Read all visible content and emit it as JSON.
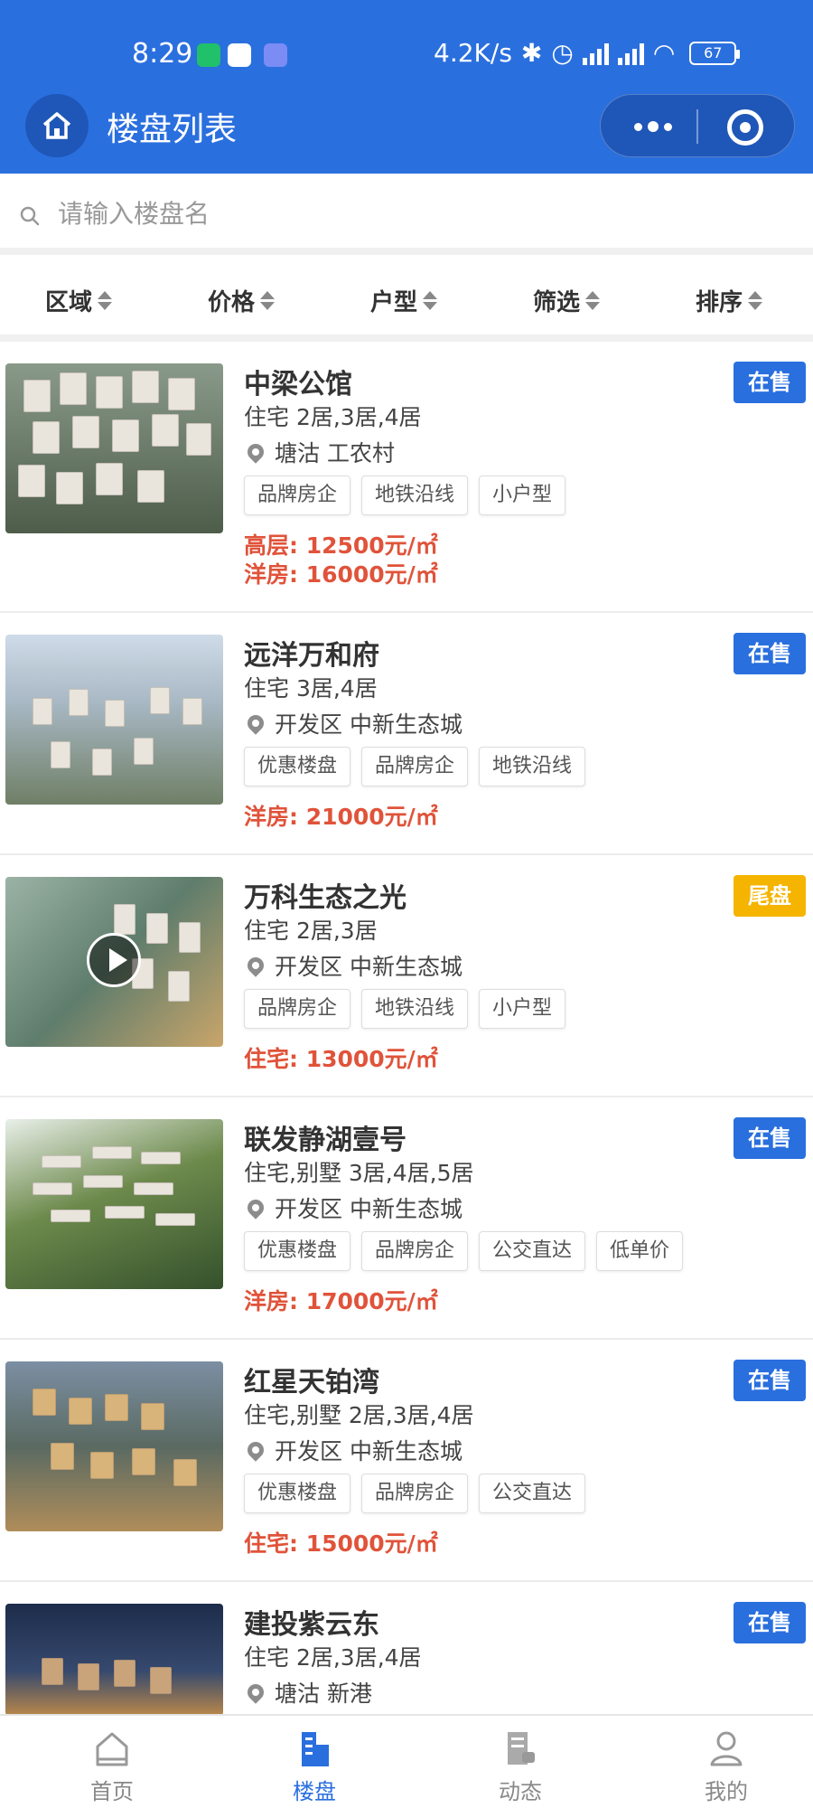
{
  "status": {
    "time": "8:29",
    "net_speed": "4.2K/s",
    "battery": "67"
  },
  "header": {
    "title": "楼盘列表"
  },
  "search": {
    "placeholder": "请输入楼盘名"
  },
  "filters": [
    "区域",
    "价格",
    "户型",
    "筛选",
    "排序"
  ],
  "colors": {
    "primary": "#2a6fde",
    "price": "#e0533a",
    "badge_on_sale": "#2a6fde",
    "badge_last": "#f5b400"
  },
  "listings": [
    {
      "name": "中梁公馆",
      "types": "住宅 2居,3居,4居",
      "location": "塘沽 工农村",
      "tags": [
        "品牌房企",
        "地铁沿线",
        "小户型"
      ],
      "prices": [
        "高层: 12500元/㎡",
        "洋房: 16000元/㎡"
      ],
      "badge": "在售",
      "badge_color": "#2a6fde"
    },
    {
      "name": "远洋万和府",
      "types": "住宅 3居,4居",
      "location": "开发区 中新生态城",
      "tags": [
        "优惠楼盘",
        "品牌房企",
        "地铁沿线"
      ],
      "prices": [
        "洋房: 21000元/㎡"
      ],
      "badge": "在售",
      "badge_color": "#2a6fde"
    },
    {
      "name": "万科生态之光",
      "types": "住宅 2居,3居",
      "location": "开发区 中新生态城",
      "tags": [
        "品牌房企",
        "地铁沿线",
        "小户型"
      ],
      "prices": [
        "住宅: 13000元/㎡"
      ],
      "badge": "尾盘",
      "badge_color": "#f5b400"
    },
    {
      "name": "联发静湖壹号",
      "types": "住宅,别墅 3居,4居,5居",
      "location": "开发区 中新生态城",
      "tags": [
        "优惠楼盘",
        "品牌房企",
        "公交直达",
        "低单价"
      ],
      "prices": [
        "洋房: 17000元/㎡"
      ],
      "badge": "在售",
      "badge_color": "#2a6fde"
    },
    {
      "name": "红星天铂湾",
      "types": "住宅,别墅 2居,3居,4居",
      "location": "开发区 中新生态城",
      "tags": [
        "优惠楼盘",
        "品牌房企",
        "公交直达"
      ],
      "prices": [
        "住宅: 15000元/㎡"
      ],
      "badge": "在售",
      "badge_color": "#2a6fde"
    },
    {
      "name": "建投紫云东",
      "types": "住宅 2居,3居,4居",
      "location": "塘沽 新港",
      "tags": [],
      "prices": [],
      "badge": "在售",
      "badge_color": "#2a6fde"
    }
  ],
  "tabbar": {
    "items": [
      {
        "label": "首页",
        "icon": "home-icon",
        "active": false
      },
      {
        "label": "楼盘",
        "icon": "building-icon",
        "active": true
      },
      {
        "label": "动态",
        "icon": "news-icon",
        "active": false
      },
      {
        "label": "我的",
        "icon": "user-icon",
        "active": false
      }
    ]
  }
}
